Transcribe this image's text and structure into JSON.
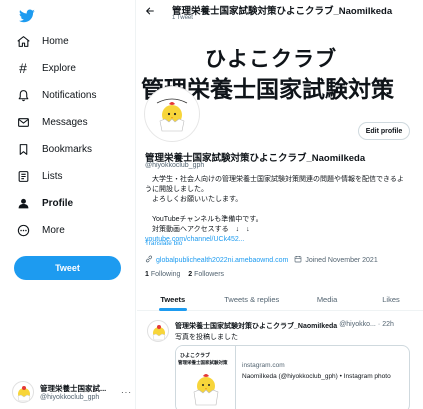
{
  "colors": {
    "accent": "#1d9bf0",
    "text": "#0f1419",
    "muted": "#536471",
    "border": "#eff3f4"
  },
  "sidebar": {
    "logo_icon": "twitter-bird-icon",
    "items": [
      {
        "label": "Home",
        "icon": "home-icon"
      },
      {
        "label": "Explore",
        "icon": "hashtag-icon"
      },
      {
        "label": "Notifications",
        "icon": "bell-icon"
      },
      {
        "label": "Messages",
        "icon": "envelope-icon"
      },
      {
        "label": "Bookmarks",
        "icon": "bookmark-icon"
      },
      {
        "label": "Lists",
        "icon": "list-icon"
      },
      {
        "label": "Profile",
        "icon": "person-icon",
        "active": true
      },
      {
        "label": "More",
        "icon": "more-circle-icon"
      }
    ],
    "tweet_button": "Tweet",
    "account": {
      "name": "管理栄養士国家試...",
      "handle": "@hiyokkoclub_gph",
      "more": "···"
    }
  },
  "header": {
    "back_icon": "arrow-left-icon",
    "title": "管理栄養士国家試験対策ひよこクラブ_NaomiIkeda",
    "subtitle": "1 Tweet"
  },
  "banner": {
    "line1": "ひよこクラブ",
    "line2": "管理栄養士国家試験対策"
  },
  "profile": {
    "edit_button": "Edit profile",
    "name": "管理栄養士国家試験対策ひよこクラブ_NaomiIkeda",
    "handle": "@hiyokkoclub_gph",
    "bio": [
      "　大学生・社会人向けの管理栄養士国家試験対策関連の問題や情報を配信できるよ",
      "うに開設しました。",
      "　よろしくお願いいたします。",
      "",
      "　YouTubeチャンネルも準備中です。",
      "　対策動画へアクセスする　↓　↓"
    ],
    "bio_link": "youtube.com/channel/UCk452...",
    "translate": "Translate bio",
    "website": "globalpublichealth2022ni.amebaownd.com",
    "joined": "Joined November 2021",
    "following_count": "1",
    "following_label": "Following",
    "followers_count": "2",
    "followers_label": "Followers"
  },
  "tabs": [
    {
      "label": "Tweets",
      "active": true
    },
    {
      "label": "Tweets & replies"
    },
    {
      "label": "Media"
    },
    {
      "label": "Likes"
    }
  ],
  "tweet": {
    "name": "管理栄養士国家試験対策ひよこクラブ_NaomiIkeda",
    "handle": "@hiyokko...",
    "dot": "·",
    "time": "22h",
    "text": "写真を投稿しました",
    "card": {
      "image_line1": "ひよこクラブ",
      "image_line2": "管理栄養士国家試験対策",
      "domain": "instagram.com",
      "title": "NaomiIkeda (@hiyokkoclub_gph) • Instagram photo"
    }
  }
}
